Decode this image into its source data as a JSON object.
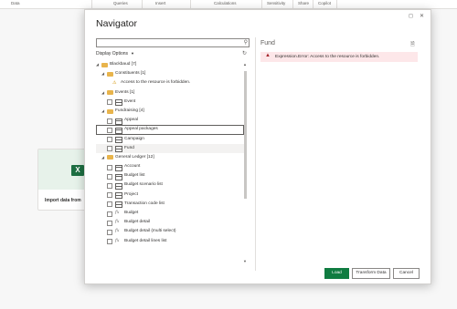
{
  "ribbon": {
    "items": [
      "Data",
      "Queries",
      "Insert",
      "Calculations",
      "Sensitivity",
      "Share",
      "Copilot"
    ]
  },
  "background": {
    "import_card_label": "Import data from"
  },
  "dialog": {
    "title": "Navigator",
    "display_options_label": "Display Options",
    "search_placeholder": "",
    "tree": [
      {
        "label": "Blackbaud [7]",
        "kind": "folder",
        "level": 0,
        "expanded": true
      },
      {
        "label": "Constituents [1]",
        "kind": "folder",
        "level": 1,
        "expanded": true
      },
      {
        "label": "Access to the resource is forbidden.",
        "kind": "warning",
        "level": 2
      },
      {
        "label": "Events [1]",
        "kind": "folder",
        "level": 1,
        "expanded": true
      },
      {
        "label": "Event",
        "kind": "table",
        "level": 2
      },
      {
        "label": "Fundraising [4]",
        "kind": "folder",
        "level": 1,
        "expanded": true
      },
      {
        "label": "Appeal",
        "kind": "table",
        "level": 2
      },
      {
        "label": "Appeal packages",
        "kind": "table",
        "level": 2,
        "selected": true
      },
      {
        "label": "Campaign",
        "kind": "table",
        "level": 2
      },
      {
        "label": "Fund",
        "kind": "table",
        "level": 2,
        "hover": true
      },
      {
        "label": "General Ledger [12]",
        "kind": "folder",
        "level": 1,
        "expanded": true
      },
      {
        "label": "Account",
        "kind": "table",
        "level": 2
      },
      {
        "label": "Budget list",
        "kind": "table",
        "level": 2
      },
      {
        "label": "Budget scenario list",
        "kind": "table",
        "level": 2
      },
      {
        "label": "Project",
        "kind": "table",
        "level": 2
      },
      {
        "label": "Transaction code list",
        "kind": "table",
        "level": 2
      },
      {
        "label": "Budget",
        "kind": "function",
        "level": 2
      },
      {
        "label": "Budget detail",
        "kind": "function",
        "level": 2
      },
      {
        "label": "Budget detail (multi select)",
        "kind": "function",
        "level": 2
      },
      {
        "label": "Budget detail lines list",
        "kind": "function",
        "level": 2
      }
    ],
    "preview": {
      "title": "Fund",
      "error": "Expression.Error: Access to the resource is forbidden."
    },
    "buttons": {
      "load": "Load",
      "transform": "Transform Data",
      "cancel": "Cancel"
    }
  },
  "colors": {
    "primary_button": "#107c41",
    "error_bg": "#fde7e9",
    "error_icon": "#a4262c",
    "folder": "#e8b44c",
    "warning": "#d39300"
  }
}
